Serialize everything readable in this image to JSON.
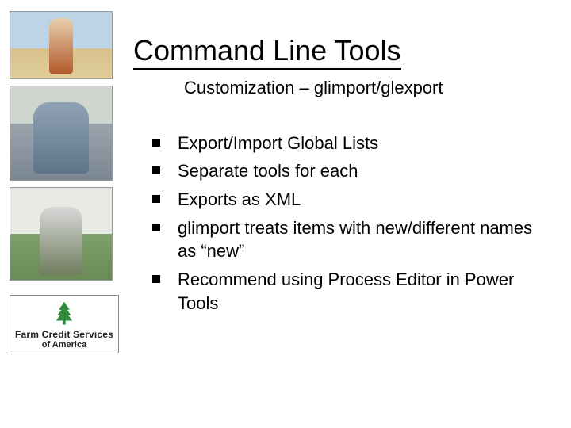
{
  "title": "Command Line Tools",
  "subtitle": "Customization – glimport/glexport",
  "bullets": [
    "Export/Import Global Lists",
    "Separate tools for each",
    "Exports as XML",
    "glimport treats items with new/different names as “new”",
    "Recommend using Process Editor in Power Tools"
  ],
  "logo": {
    "line1": "Farm Credit Services",
    "line2": "of America"
  }
}
